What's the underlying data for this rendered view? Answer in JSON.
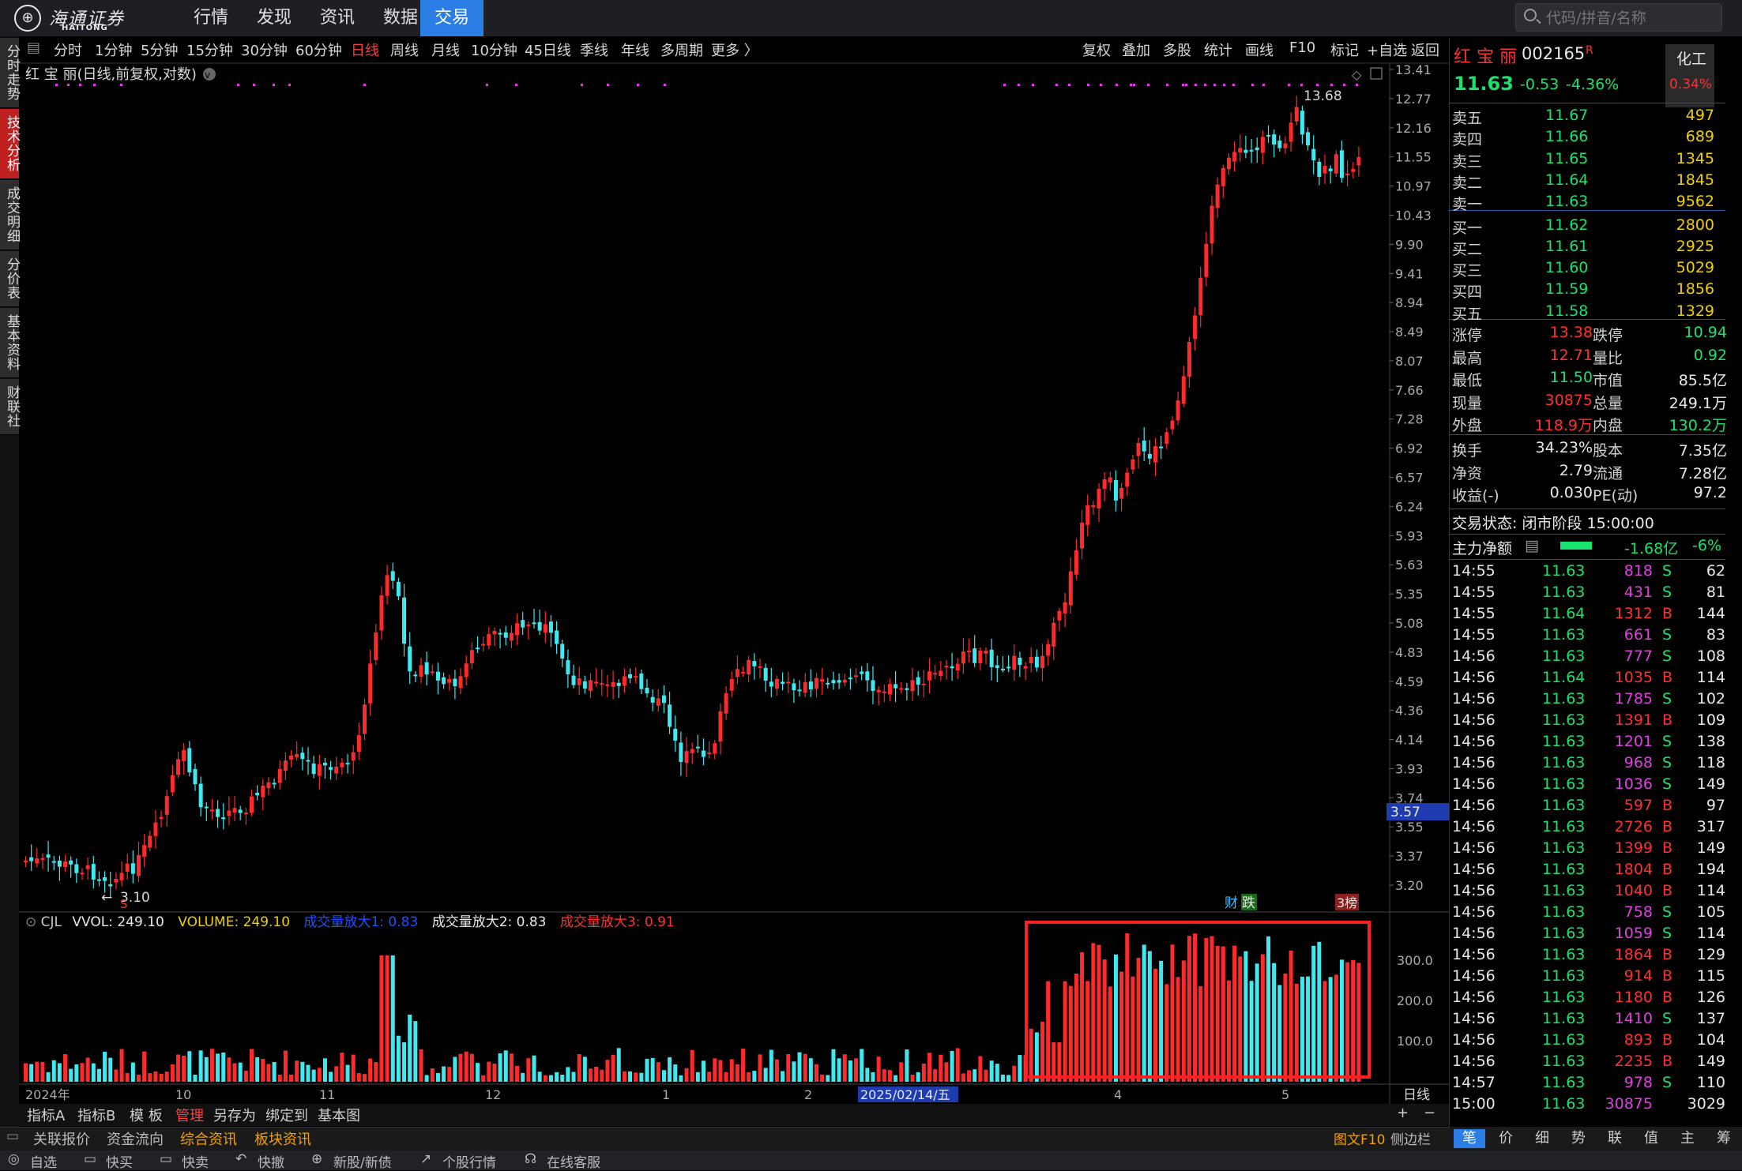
{
  "app": {
    "logo_cn": "海通证券",
    "logo_en": "HAITONG",
    "nav": [
      "行情",
      "发现",
      "资讯",
      "数据",
      "交易"
    ],
    "active_nav": "交易",
    "search_placeholder": "代码/拼音/名称"
  },
  "left_tabs": [
    "分时走势",
    "技术分析",
    "成交明细",
    "分价表",
    "基本资料",
    "财联社"
  ],
  "toolbar": {
    "periods": [
      "分时",
      "1分钟",
      "5分钟",
      "15分钟",
      "30分钟",
      "60分钟",
      "日线",
      "周线",
      "月线",
      "10分钟",
      "45日线",
      "季线",
      "年线",
      "多周期",
      "更多 〉"
    ],
    "active_period": "日线",
    "tools": [
      "复权",
      "叠加",
      "多股",
      "统计",
      "画线",
      "F10",
      "标记",
      "+自选",
      "返回"
    ]
  },
  "chart": {
    "title": "红 宝 丽(日线,前复权,对数)",
    "price_labels": [
      "13.41",
      "12.77",
      "12.16",
      "11.55",
      "10.97",
      "10.43",
      "9.90",
      "9.41",
      "8.94",
      "8.49",
      "8.07",
      "7.66",
      "7.28",
      "6.92",
      "6.57",
      "6.24",
      "5.93",
      "5.63",
      "5.35",
      "5.08",
      "4.83",
      "4.59",
      "4.36",
      "4.14",
      "3.93",
      "3.74",
      "3.55",
      "3.37",
      "3.20"
    ],
    "current_price_tag": "3.57",
    "high_label": "13.68",
    "low_label": "3.10",
    "markers": [
      "财",
      "跌",
      "3榜"
    ],
    "date_labels": [
      "2024年",
      "10",
      "11",
      "12",
      "1",
      "2",
      "2025/02/14/五",
      "4",
      "5"
    ],
    "period_label": "日线"
  },
  "volume_panel": {
    "legend": [
      {
        "text": "CJL",
        "color": "#c8c8c8"
      },
      {
        "text": "VVOL: 249.10",
        "color": "#e8e8e8"
      },
      {
        "text": "VOLUME: 249.10",
        "color": "#f0d000"
      },
      {
        "text": "成交量放大1: 0.83",
        "color": "#2050ff"
      },
      {
        "text": "成交量放大2: 0.83",
        "color": "#e8e8e8"
      },
      {
        "text": "成交量放大3: 0.91",
        "color": "#ff3030"
      }
    ],
    "axis_labels": [
      "300.0",
      "200.0",
      "100.0"
    ]
  },
  "quote": {
    "name": "红 宝 丽",
    "code": "002165",
    "flag": "R",
    "sector": "化工",
    "sector_change": "0.34%",
    "price": "11.63",
    "change": "-0.53",
    "change_pct": "-4.36%",
    "asks": [
      {
        "label": "卖五",
        "price": "11.67",
        "vol": "497"
      },
      {
        "label": "卖四",
        "price": "11.66",
        "vol": "689"
      },
      {
        "label": "卖三",
        "price": "11.65",
        "vol": "1345"
      },
      {
        "label": "卖二",
        "price": "11.64",
        "vol": "1845"
      },
      {
        "label": "卖一",
        "price": "11.63",
        "vol": "9562"
      }
    ],
    "bids": [
      {
        "label": "买一",
        "price": "11.62",
        "vol": "2800"
      },
      {
        "label": "买二",
        "price": "11.61",
        "vol": "2925"
      },
      {
        "label": "买三",
        "price": "11.60",
        "vol": "5029"
      },
      {
        "label": "买四",
        "price": "11.59",
        "vol": "1856"
      },
      {
        "label": "买五",
        "price": "11.58",
        "vol": "1329"
      }
    ],
    "stats": [
      {
        "l1": "涨停",
        "v1": "13.38",
        "c1": "r",
        "l2": "跌停",
        "v2": "10.94",
        "c2": "g"
      },
      {
        "l1": "最高",
        "v1": "12.71",
        "c1": "r",
        "l2": "量比",
        "v2": "0.92",
        "c2": "g"
      },
      {
        "l1": "最低",
        "v1": "11.50",
        "c1": "g",
        "l2": "市值",
        "v2": "85.5亿",
        "c2": "w"
      },
      {
        "l1": "现量",
        "v1": "30875",
        "c1": "r",
        "l2": "总量",
        "v2": "249.1万",
        "c2": "w"
      },
      {
        "l1": "外盘",
        "v1": "118.9万",
        "c1": "r",
        "l2": "内盘",
        "v2": "130.2万",
        "c2": "g"
      }
    ],
    "stats2": [
      {
        "l1": "换手",
        "v1": "34.23%",
        "l2": "股本",
        "v2": "7.35亿"
      },
      {
        "l1": "净资",
        "v1": "2.79",
        "l2": "流通",
        "v2": "7.28亿"
      },
      {
        "l1": "收益(-)",
        "v1": "0.030",
        "l2": "PE(动)",
        "v2": "97.2"
      }
    ],
    "trade_status": "交易状态: 闭市阶段 15:00:00",
    "main_flow_label": "主力净额",
    "main_flow_value": "-1.68亿",
    "main_flow_pct": "-6%"
  },
  "ticks": [
    {
      "t": "14:55",
      "p": "11.63",
      "v": "818",
      "s": "S",
      "n": "62"
    },
    {
      "t": "14:55",
      "p": "11.63",
      "v": "431",
      "s": "S",
      "n": "81"
    },
    {
      "t": "14:55",
      "p": "11.64",
      "v": "1312",
      "s": "B",
      "n": "144"
    },
    {
      "t": "14:55",
      "p": "11.63",
      "v": "661",
      "s": "S",
      "n": "83"
    },
    {
      "t": "14:56",
      "p": "11.63",
      "v": "777",
      "s": "S",
      "n": "108"
    },
    {
      "t": "14:56",
      "p": "11.64",
      "v": "1035",
      "s": "B",
      "n": "114"
    },
    {
      "t": "14:56",
      "p": "11.63",
      "v": "1785",
      "s": "S",
      "n": "102"
    },
    {
      "t": "14:56",
      "p": "11.63",
      "v": "1391",
      "s": "B",
      "n": "109"
    },
    {
      "t": "14:56",
      "p": "11.63",
      "v": "1201",
      "s": "S",
      "n": "138"
    },
    {
      "t": "14:56",
      "p": "11.63",
      "v": "968",
      "s": "S",
      "n": "118"
    },
    {
      "t": "14:56",
      "p": "11.63",
      "v": "1036",
      "s": "S",
      "n": "149"
    },
    {
      "t": "14:56",
      "p": "11.63",
      "v": "597",
      "s": "B",
      "n": "97"
    },
    {
      "t": "14:56",
      "p": "11.63",
      "v": "2726",
      "s": "B",
      "n": "317"
    },
    {
      "t": "14:56",
      "p": "11.63",
      "v": "1399",
      "s": "B",
      "n": "149"
    },
    {
      "t": "14:56",
      "p": "11.63",
      "v": "1804",
      "s": "B",
      "n": "194"
    },
    {
      "t": "14:56",
      "p": "11.63",
      "v": "1040",
      "s": "B",
      "n": "114"
    },
    {
      "t": "14:56",
      "p": "11.63",
      "v": "758",
      "s": "S",
      "n": "105"
    },
    {
      "t": "14:56",
      "p": "11.63",
      "v": "1059",
      "s": "S",
      "n": "114"
    },
    {
      "t": "14:56",
      "p": "11.63",
      "v": "1864",
      "s": "B",
      "n": "129"
    },
    {
      "t": "14:56",
      "p": "11.63",
      "v": "914",
      "s": "B",
      "n": "115"
    },
    {
      "t": "14:56",
      "p": "11.63",
      "v": "1180",
      "s": "B",
      "n": "126"
    },
    {
      "t": "14:56",
      "p": "11.63",
      "v": "1410",
      "s": "S",
      "n": "137"
    },
    {
      "t": "14:56",
      "p": "11.63",
      "v": "893",
      "s": "B",
      "n": "104"
    },
    {
      "t": "14:56",
      "p": "11.63",
      "v": "2235",
      "s": "B",
      "n": "149"
    },
    {
      "t": "14:57",
      "p": "11.63",
      "v": "978",
      "s": "S",
      "n": "110"
    },
    {
      "t": "15:00",
      "p": "11.63",
      "v": "30875",
      "s": "",
      "n": "3029"
    }
  ],
  "right_tabs": [
    "笔",
    "价",
    "细",
    "势",
    "联",
    "值",
    "主",
    "筹"
  ],
  "index_tabs": [
    "指标A",
    "指标B",
    "模 板",
    "管理",
    "另存为",
    "绑定到",
    "基本图"
  ],
  "bottom_tabs": [
    "关联报价",
    "资金流向",
    "综合资讯",
    "板块资讯"
  ],
  "bottom_right": [
    "图文F10",
    "侧边栏"
  ],
  "status_items": [
    "自选",
    "快买",
    "快卖",
    "快撤",
    "新股/新债",
    "个股行情",
    "在线客服"
  ]
}
